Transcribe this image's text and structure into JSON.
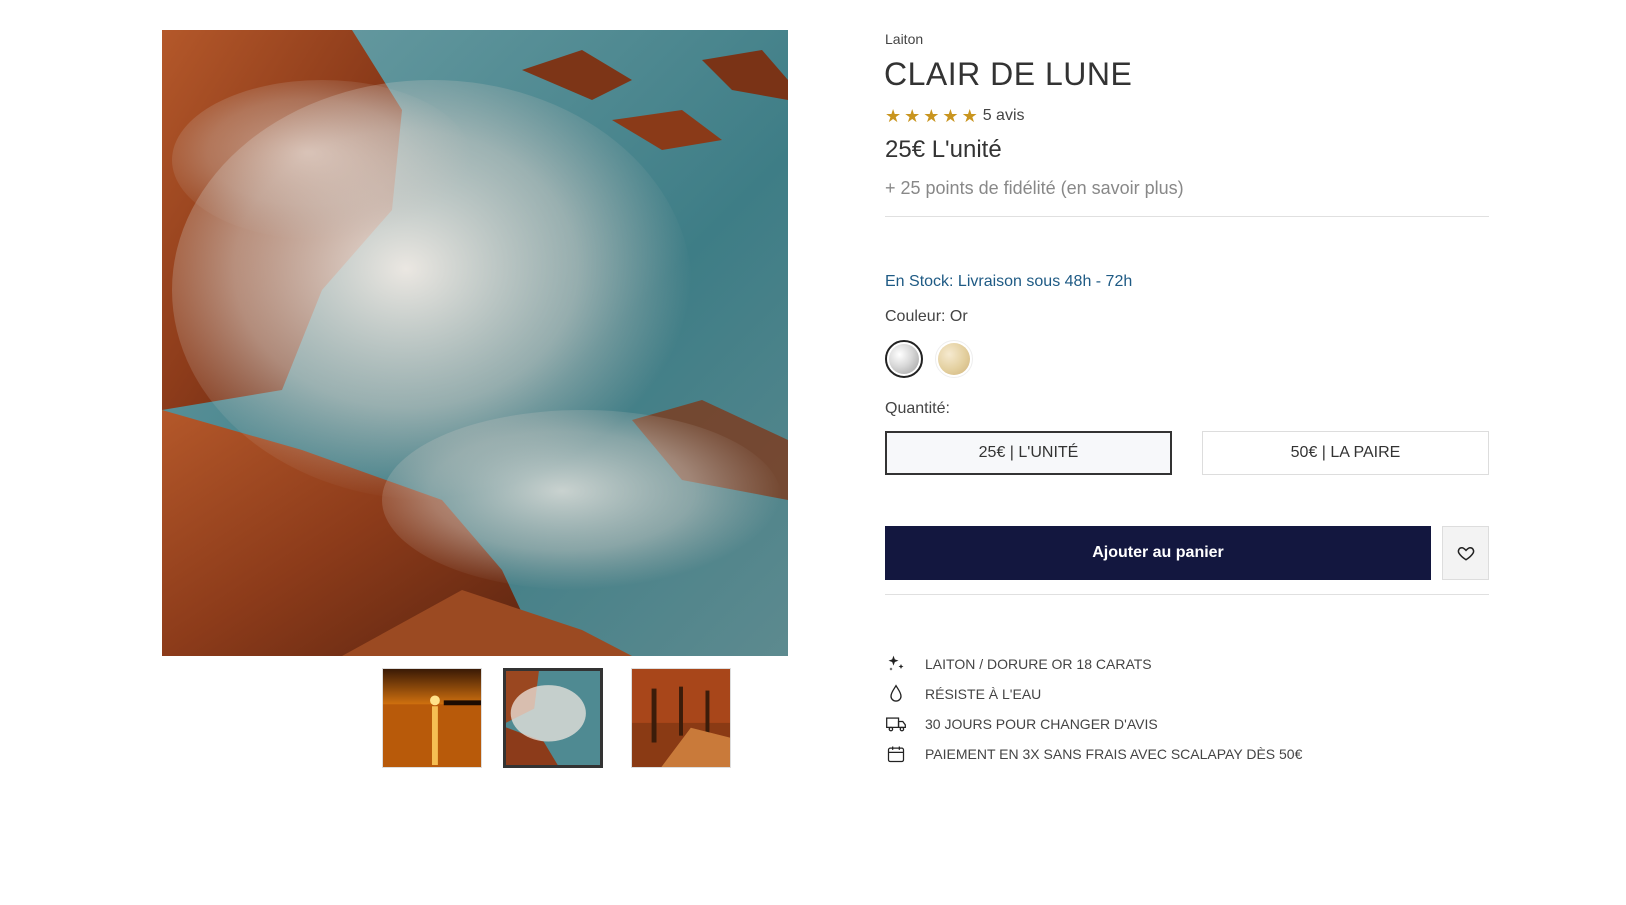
{
  "gallery": {
    "main_image": "misty rocky coast photo",
    "thumbnails": [
      {
        "name": "sunset-over-sea",
        "active": false
      },
      {
        "name": "misty-rocky-coast",
        "active": true
      },
      {
        "name": "autumn-tree-alley",
        "active": false
      }
    ]
  },
  "product": {
    "brand": "Laiton",
    "title": "CLAIR DE LUNE",
    "rating": 5,
    "reviews": "5 avis",
    "price": "25€ L'unité",
    "loyalty": "+ 25 points de fidélité (en savoir plus)"
  },
  "availability": {
    "stock": "En Stock: Livraison sous 48h - 72h"
  },
  "color": {
    "label": "Couleur: Or",
    "swatches": [
      {
        "name": "silver",
        "color": "#c8c8c8",
        "selected": true
      },
      {
        "name": "gold",
        "color": "#e3cf9e",
        "selected": false
      }
    ]
  },
  "quantity": {
    "label": "Quantité:",
    "options": [
      {
        "label": "25€ | L'UNITÉ",
        "selected": true
      },
      {
        "label": "50€ | LA PAIRE",
        "selected": false
      }
    ]
  },
  "actions": {
    "add_to_cart": "Ajouter au panier",
    "wishlist_icon": "heart-icon"
  },
  "features": [
    {
      "icon": "sparkles-icon",
      "text": "LAITON / DORURE OR 18 CARATS"
    },
    {
      "icon": "droplet-icon",
      "text": "RÉSISTE À L'EAU"
    },
    {
      "icon": "delivery-truck-icon",
      "text": "30 JOURS POUR CHANGER D'AVIS"
    },
    {
      "icon": "calendar-icon",
      "text": "PAIEMENT EN 3X SANS FRAIS AVEC SCALAPAY DÈS 50€"
    }
  ],
  "colors": {
    "accent": "#13173f",
    "star": "#c9951f",
    "stock": "#1e5a84"
  }
}
